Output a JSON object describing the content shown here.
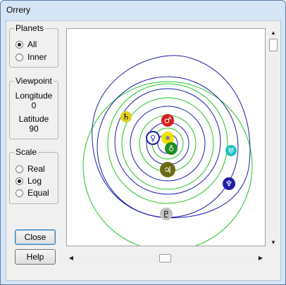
{
  "window": {
    "title": "Orrery"
  },
  "planets_group": {
    "legend": "Planets",
    "options": [
      {
        "label": "All",
        "checked": true
      },
      {
        "label": "Inner",
        "checked": false
      }
    ]
  },
  "viewpoint_group": {
    "legend": "Viewpoint",
    "longitude_label": "Longitude",
    "longitude_value": "0",
    "latitude_label": "Latitude",
    "latitude_value": "90"
  },
  "scale_group": {
    "legend": "Scale",
    "options": [
      {
        "label": "Real",
        "checked": false
      },
      {
        "label": "Log",
        "checked": true
      },
      {
        "label": "Equal",
        "checked": false
      }
    ]
  },
  "buttons": {
    "close": "Close",
    "help": "Help"
  },
  "orrery": {
    "colors": {
      "orbit_green": "#22c422",
      "orbit_blue": "#1e1ea8"
    },
    "planets": [
      {
        "name": "mercury",
        "symbol": "☿",
        "color": "#1e1ea8"
      },
      {
        "name": "venus",
        "symbol": "♀",
        "color": "#1e1ea8"
      },
      {
        "name": "earth",
        "symbol": "♁",
        "color": "#1e8f1e"
      },
      {
        "name": "mars",
        "symbol": "♂",
        "color": "#d81e1e"
      },
      {
        "name": "jupiter",
        "symbol": "♃",
        "color": "#6b6b14"
      },
      {
        "name": "saturn",
        "symbol": "♄",
        "color": "#e0d020"
      },
      {
        "name": "uranus",
        "symbol": "♅",
        "color": "#22c0c0"
      },
      {
        "name": "neptune",
        "symbol": "♆",
        "color": "#1e1ea8"
      },
      {
        "name": "pluto",
        "symbol": "♇",
        "color": "#b0b0b0"
      }
    ],
    "sun": {
      "symbol": "☉",
      "color": "#f0e000"
    }
  },
  "scrollbars": {
    "vertical_position": 0.0,
    "horizontal_position": 0.5
  }
}
